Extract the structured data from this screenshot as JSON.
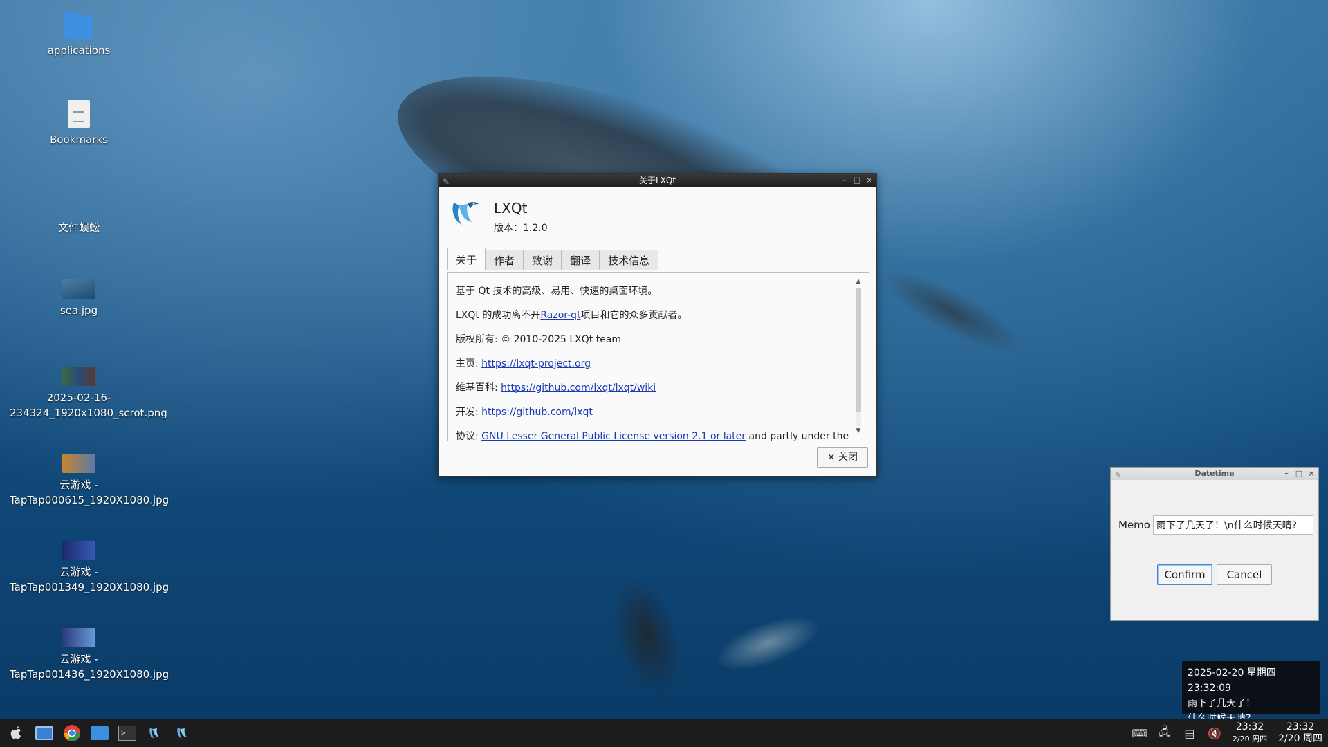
{
  "desktop": {
    "icons": [
      {
        "label": "applications",
        "kind": "folder"
      },
      {
        "label": "Bookmarks",
        "kind": "document"
      },
      {
        "label": "文件蜈蚣",
        "kind": "none"
      },
      {
        "label": "sea.jpg",
        "kind": "image"
      },
      {
        "label": "2025-02-16-234324_1920x1080_scrot.png",
        "kind": "image"
      },
      {
        "label": "云游戏 - TapTap000615_1920X1080.jpg",
        "kind": "image"
      },
      {
        "label": "云游戏 - TapTap001349_1920X1080.jpg",
        "kind": "image"
      },
      {
        "label": "云游戏 - TapTap001436_1920X1080.jpg",
        "kind": "image"
      }
    ]
  },
  "about_dialog": {
    "title": "关于LXQt",
    "app_name": "LXQt",
    "version": "版本：1.2.0",
    "tabs": [
      "关于",
      "作者",
      "致谢",
      "翻译",
      "技术信息"
    ],
    "active_tab": "关于",
    "lines": {
      "description": "基于 Qt 技术的高级、易用、快速的桌面环境。",
      "razor_prefix": "LXQt 的成功离不开",
      "razor_link": "Razor-qt",
      "razor_suffix": "项目和它的众多贡献者。",
      "copyright": "版权所有: © 2010-2025 LXQt team",
      "homepage_label": "主页:",
      "homepage_link": "https://lxqt-project.org",
      "wiki_label": "维基百科:",
      "wiki_link": "https://github.com/lxqt/lxqt/wiki",
      "dev_label": "开发:",
      "dev_link": "https://github.com/lxqt",
      "license_label": "协议:",
      "license_link": "GNU Lesser General Public License version 2.1 or later",
      "license_suffix": "and partly under the"
    },
    "close_label": "× 关闭"
  },
  "datetime_dialog": {
    "title": "Datetime",
    "memo_label": "Memo",
    "memo_value": "雨下了几天了！\\n什么时候天晴?",
    "confirm_label": "Confirm",
    "cancel_label": "Cancel"
  },
  "notification": {
    "line1": "2025-02-20 星期四 23:32:09",
    "line2": "雨下了几天了！",
    "line3": "什么时候天晴?"
  },
  "taskbar": {
    "launchers": [
      "apple-menu-icon",
      "desktop-icon",
      "chrome-icon",
      "file-manager-icon",
      "terminal-icon",
      "lxqt-icon",
      "lxqt-icon"
    ],
    "clock1_time": "23:32",
    "clock1_date": "2/20 周四",
    "clock2_time": "23:32",
    "clock2_date": "2/20 周四"
  },
  "colors": {
    "link": "#1a3bb5",
    "taskbar": "#1c1c1c",
    "titlebar": "#2a2a2a"
  }
}
